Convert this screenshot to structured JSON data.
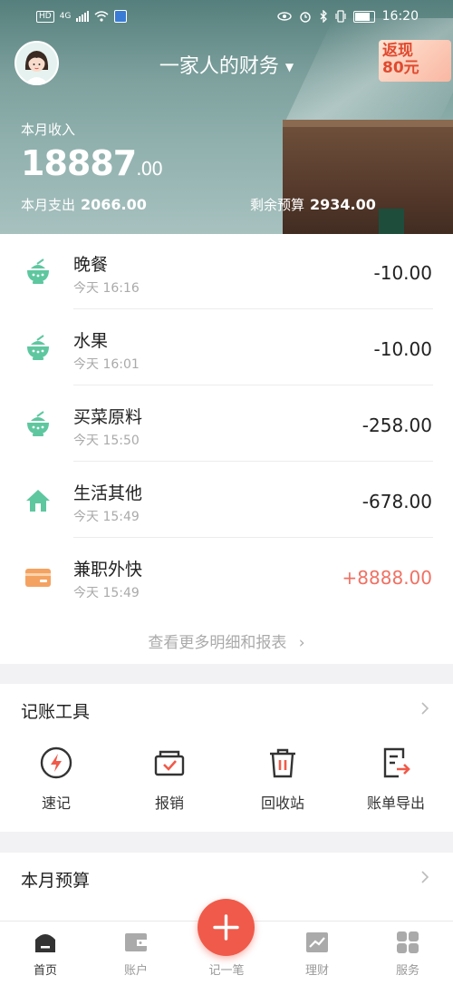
{
  "statusbar": {
    "hd": "HD",
    "network": "4G",
    "time": "16:20"
  },
  "header": {
    "title": "一家人的财务",
    "promo": {
      "line1": "返现",
      "line2": "80元"
    },
    "income_label": "本月收入",
    "income_int": "18887",
    "income_dec": ".00",
    "expense_label": "本月支出",
    "expense_value": "2066.00",
    "budget_label": "剩余预算",
    "budget_value": "2934.00"
  },
  "transactions": [
    {
      "name": "晚餐",
      "time": "今天 16:16",
      "amount": "-10.00",
      "icon": "bowl-icon"
    },
    {
      "name": "水果",
      "time": "今天 16:01",
      "amount": "-10.00",
      "icon": "bowl-icon"
    },
    {
      "name": "买菜原料",
      "time": "今天 15:50",
      "amount": "-258.00",
      "icon": "bowl-icon"
    },
    {
      "name": "生活其他",
      "time": "今天 15:49",
      "amount": "-678.00",
      "icon": "house-icon"
    },
    {
      "name": "兼职外快",
      "time": "今天 15:49",
      "amount": "+8888.00",
      "icon": "wallet-icon"
    }
  ],
  "more_link": "查看更多明细和报表",
  "tools": {
    "title": "记账工具",
    "items": [
      {
        "label": "速记",
        "icon": "lightning-icon"
      },
      {
        "label": "报销",
        "icon": "reimburse-icon"
      },
      {
        "label": "回收站",
        "icon": "trash-icon"
      },
      {
        "label": "账单导出",
        "icon": "export-icon"
      }
    ]
  },
  "budget_section": {
    "title": "本月预算"
  },
  "nav": {
    "items": [
      {
        "label": "首页",
        "icon": "home-icon"
      },
      {
        "label": "账户",
        "icon": "wallet-icon"
      },
      {
        "label": "记一笔",
        "icon": "plus-icon"
      },
      {
        "label": "理财",
        "icon": "chart-icon"
      },
      {
        "label": "服务",
        "icon": "grid-icon"
      }
    ]
  },
  "colors": {
    "accent": "#f05a4a",
    "green": "#5ec7a0",
    "income": "#f07163",
    "wallet": "#f4a261"
  }
}
